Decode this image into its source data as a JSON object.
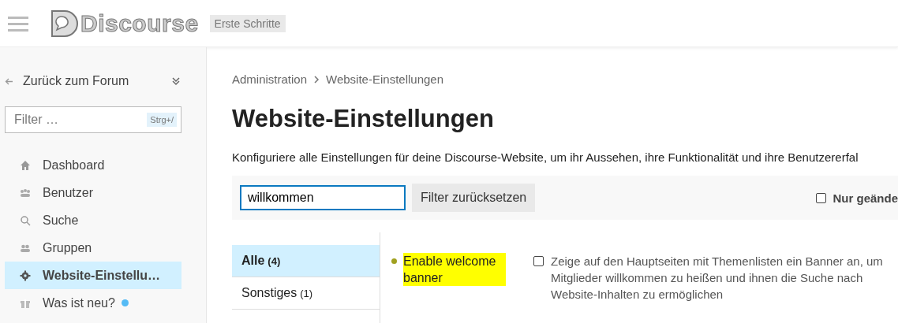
{
  "header": {
    "logo_text": "Discourse",
    "badge": "Erste Schritte"
  },
  "sidebar": {
    "back_link": "Zurück zum Forum",
    "filter": {
      "placeholder": "Filter …",
      "shortcut": "Strg+/"
    },
    "items": [
      {
        "label": "Dashboard",
        "selected": false,
        "new": false
      },
      {
        "label": "Benutzer",
        "selected": false,
        "new": false
      },
      {
        "label": "Suche",
        "selected": false,
        "new": false
      },
      {
        "label": "Gruppen",
        "selected": false,
        "new": false
      },
      {
        "label": "Website-Einstellu…",
        "selected": true,
        "new": false
      },
      {
        "label": "Was ist neu?",
        "selected": false,
        "new": true
      }
    ]
  },
  "breadcrumb": [
    "Administration",
    "Website-Einstellungen"
  ],
  "title": "Website-Einstellungen",
  "description": "Konfiguriere alle Einstellungen für deine Discourse-Website, um ihr Aussehen, ihre Funktionalität und ihre Benutzererfal",
  "filter_bar": {
    "value": "willkommen",
    "reset_button": "Filter zurücksetzen",
    "only_changed": {
      "label": "Nur geände",
      "checked": false
    }
  },
  "categories": [
    {
      "label": "Alle",
      "count": "(4)",
      "selected": true
    },
    {
      "label": "Sonstiges",
      "count": "(1)",
      "selected": false
    }
  ],
  "settings": [
    {
      "name": "Enable welcome banner",
      "highlighted": true,
      "checked": false,
      "description": "Zeige auf den Hauptseiten mit Themenlisten ein Banner an, um Mitglieder willkommen zu heißen und ihnen die Suche nach Website-Inhalten zu ermöglichen"
    }
  ]
}
